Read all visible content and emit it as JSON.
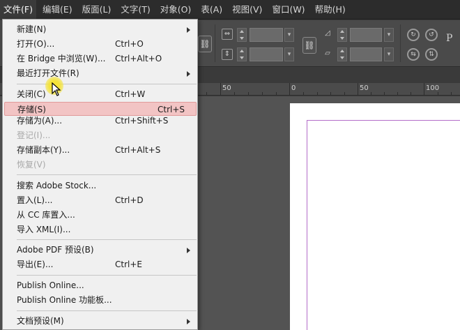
{
  "menubar": {
    "items": [
      {
        "label": "文件(F)",
        "name": "menu-file"
      },
      {
        "label": "编辑(E)",
        "name": "menu-edit"
      },
      {
        "label": "版面(L)",
        "name": "menu-layout"
      },
      {
        "label": "文字(T)",
        "name": "menu-type"
      },
      {
        "label": "对象(O)",
        "name": "menu-object"
      },
      {
        "label": "表(A)",
        "name": "menu-table"
      },
      {
        "label": "视图(V)",
        "name": "menu-view"
      },
      {
        "label": "窗口(W)",
        "name": "menu-window"
      },
      {
        "label": "帮助(H)",
        "name": "menu-help"
      }
    ]
  },
  "file_menu": {
    "items": {
      "new": {
        "label": "新建(N)"
      },
      "open": {
        "label": "打开(O)...",
        "shortcut": "Ctrl+O"
      },
      "browse_bridge": {
        "label": "在 Bridge 中浏览(W)...",
        "shortcut": "Ctrl+Alt+O"
      },
      "open_recent": {
        "label": "最近打开文件(R)"
      },
      "close": {
        "label": "关闭(C)",
        "shortcut": "Ctrl+W"
      },
      "save": {
        "label": "存储(S)",
        "shortcut": "Ctrl+S"
      },
      "save_as": {
        "label": "存储为(A)...",
        "shortcut": "Ctrl+Shift+S"
      },
      "check_in": {
        "label": "登记(I)..."
      },
      "save_copy": {
        "label": "存储副本(Y)...",
        "shortcut": "Ctrl+Alt+S"
      },
      "revert": {
        "label": "恢复(V)"
      },
      "search_stock": {
        "label": "搜索 Adobe Stock..."
      },
      "place": {
        "label": "置入(L)...",
        "shortcut": "Ctrl+D"
      },
      "place_cc": {
        "label": "从 CC 库置入..."
      },
      "import_xml": {
        "label": "导入 XML(I)..."
      },
      "pdf_presets": {
        "label": "Adobe PDF 预设(B)"
      },
      "export": {
        "label": "导出(E)...",
        "shortcut": "Ctrl+E"
      },
      "publish_online": {
        "label": "Publish Online..."
      },
      "publish_dashboard": {
        "label": "Publish Online 功能板..."
      },
      "doc_presets": {
        "label": "文档预设(M)"
      }
    }
  },
  "control_panel": {
    "letter": "P"
  },
  "ruler": {
    "labels": [
      "50",
      "0",
      "50",
      "100"
    ]
  },
  "colors": {
    "menu_highlight": "#f2c4c4",
    "margin_guide": "#b36cc8",
    "cursor_halo": "#f4e33a"
  }
}
